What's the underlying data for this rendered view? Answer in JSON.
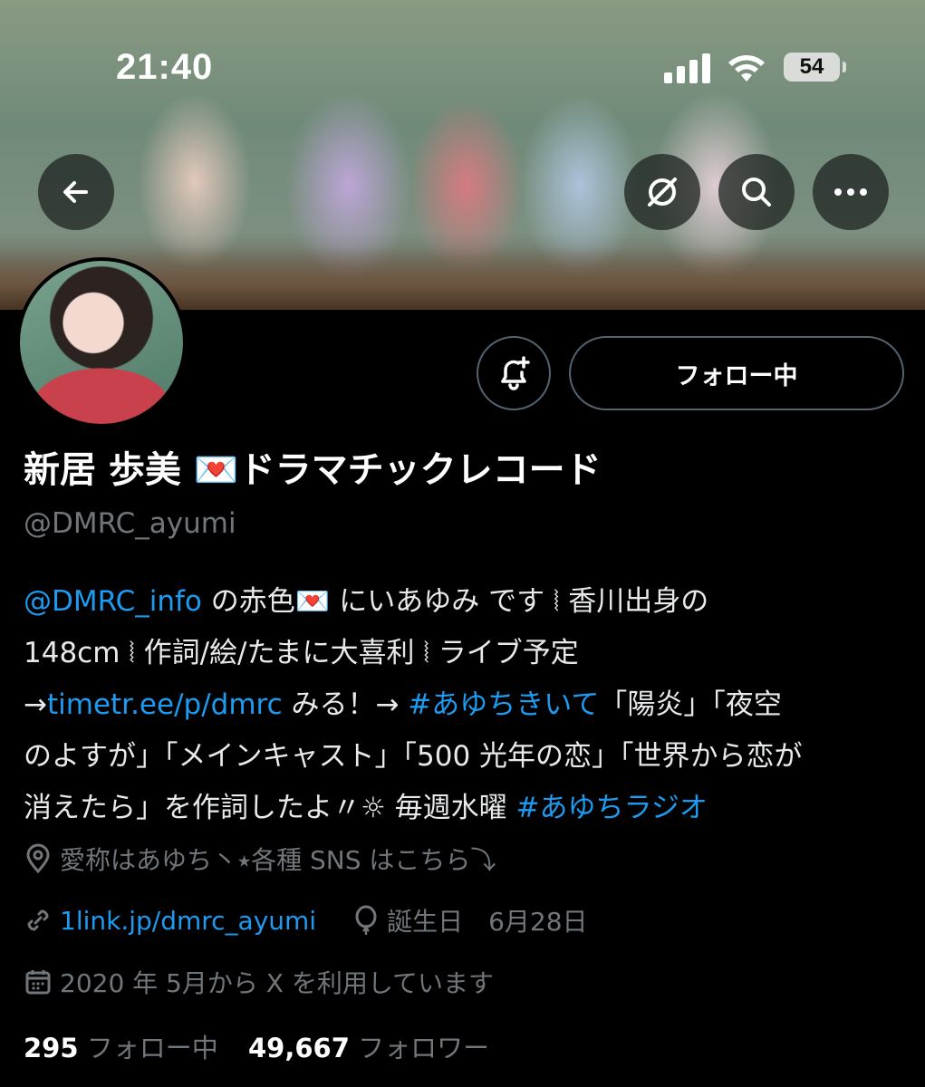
{
  "status_bar": {
    "time": "21:40",
    "battery": "54"
  },
  "nav": {
    "back_icon": "arrow-left-icon",
    "grok_icon": "slash-circle-icon",
    "search_icon": "search-icon",
    "more_icon": "more-horizontal-icon"
  },
  "profile": {
    "name_text": "新居 歩美 💌ドラマチックレコード",
    "handle": "@DMRC_ayumi",
    "bell_icon": "bell-plus-icon",
    "follow_label": "フォロー中",
    "bio": {
      "line1_mention": "@DMRC_info",
      "line1_rest": " の赤色💌 にいあゆみ です ⦚ 香川出身の",
      "line2": "148cm ⦚ 作詞/絵/たまに大喜利 ⦚ ライブ予定",
      "line3_arrow": "→",
      "line3_link": "timetr.ee/p/dmrc",
      "line3_mid": " みる！→ ",
      "line3_hashtag": "#あゆちきいて",
      "line3_rest": "「陽炎」「夜空",
      "line4": "のよすが」「メインキャスト」「500 光年の恋」「世界から恋が",
      "line5_text": "消えたら」を作詞したよ〃☼ 毎週水曜 ",
      "line5_hashtag": "#あゆちラジオ"
    },
    "location": "愛称はあゆち丶⭑各種 SNS はこちら⤵︎",
    "website": "1link.jp/dmrc_ayumi",
    "birthday": "誕生日　6月28日",
    "joined": "2020 年 5月から X を利用しています",
    "following_count": "295",
    "following_label": "フォロー中",
    "followers_count": "49,667",
    "followers_label": "フォロワー"
  },
  "colors": {
    "background": "#000000",
    "text": "#e7e9ea",
    "secondary": "#71767b",
    "link": "#1d9bf0",
    "border": "#536471"
  }
}
